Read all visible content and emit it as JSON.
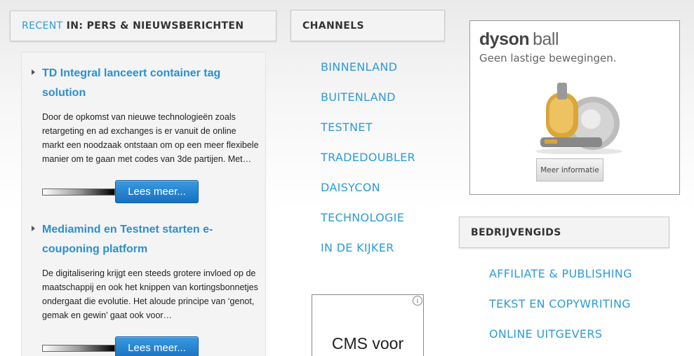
{
  "recent_header": {
    "accent": "RECENT",
    "label": "IN: PERS & NIEUWSBERICHTEN"
  },
  "channels_header": "CHANNELS",
  "channels": [
    "BINNENLAND",
    "BUITENLAND",
    "TESTNET",
    "TRADEDOUBLER",
    "DAISYCON",
    "TECHNOLOGIE",
    "IN DE KIJKER"
  ],
  "articles": [
    {
      "title": "TD Integral lanceert container tag solution",
      "excerpt": "Door de opkomst van nieuwe technologieën zoals retargeting en ad exchanges is er vanuit de online markt een noodzaak ontstaan om op een meer flexibele manier om te gaan met codes van 3de partijen. Met…",
      "more": "Lees meer..."
    },
    {
      "title": "Mediamind en Testnet starten e-couponing platform",
      "excerpt": "De digitalisering krijgt een steeds grotere invloed op de maatschappij en ook het knippen van kortingsbonnetjes ondergaat die evolutie. Het aloude principe van ‘genot, gemak en gewin’ gaat ook voor…",
      "more": "Lees meer..."
    }
  ],
  "dyson_ad": {
    "brand": "dyson",
    "product": "ball",
    "tagline": "Geen lastige bewegingen.",
    "button": "Meer informatie"
  },
  "cms_ad": {
    "title": "CMS voor",
    "icon": "info-icon"
  },
  "bedrijvengids_header": "BEDRIJVENGIDS",
  "bedrijvengids": [
    "AFFILIATE & PUBLISHING",
    "TEKST EN COPYWRITING",
    "ONLINE UITGEVERS"
  ],
  "colors": {
    "accent": "#2f9bd6",
    "button": "#1f7cc8"
  }
}
